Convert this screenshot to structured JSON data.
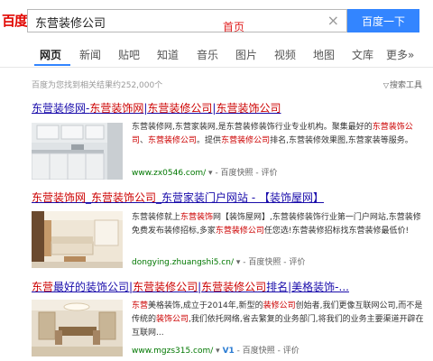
{
  "header": {
    "logo": "百度",
    "search_value": "东营装修公司",
    "home_label": "首页",
    "search_button": "百度一下",
    "clear_icon": "×"
  },
  "tabs": [
    "网页",
    "新闻",
    "贴吧",
    "知道",
    "音乐",
    "图片",
    "视频",
    "地图",
    "文库",
    "更多»"
  ],
  "result_count": "百度为您找到相关结果约252,000个",
  "tools_label": "搜索工具",
  "results": [
    {
      "title_parts": [
        "东营装修网-",
        "东营装饰网",
        "|",
        "东营装修公司",
        "|",
        "东营装饰公司"
      ],
      "snippet_parts": [
        "东营装修网,东营家装网,是东营装修装饰行业专业机构。聚集最好的",
        "东营装饰公司",
        "、",
        "东营装修公司",
        "。提供",
        "东营装修公司",
        "排名,东营装修效果图,东营家装等服务。"
      ],
      "url": "www.zx0546.com/",
      "snapshot": "百度快照",
      "rating": "评价"
    },
    {
      "title_parts": [
        "东营装饰网",
        "_",
        "东营装饰公司",
        "_东营家装门户网站 - 【装饰屋网】"
      ],
      "snippet_parts": [
        "东营装修就上",
        "东营装饰",
        "网【装饰屋网】,东营装修装饰行业第一门户网站,东营装修免费发布装修招标,多家",
        "东营装修公司",
        "任您选!东营装修招标找东营装修最低价!"
      ],
      "url": "dongying.zhuangshi5.cn/",
      "snapshot": "百度快照",
      "rating": "评价"
    },
    {
      "title_parts": [
        "东营",
        "最好的装饰公司|",
        "东营装修公司",
        "|",
        "东营装修公司",
        "排名|美格装饰-..."
      ],
      "snippet_parts": [
        "东营",
        "美格装饰,成立于2014年,新型的",
        "装修公司",
        "创始者,我们更像互联网公司,而不是传统的",
        "装饰公司",
        ",我们依托网络,省去繁复的业务部门,将我们的业务主要渠道开辟在互联网..."
      ],
      "url": "www.mgzs315.com/",
      "badge": "V1",
      "snapshot": "百度快照",
      "rating": "评价"
    }
  ]
}
